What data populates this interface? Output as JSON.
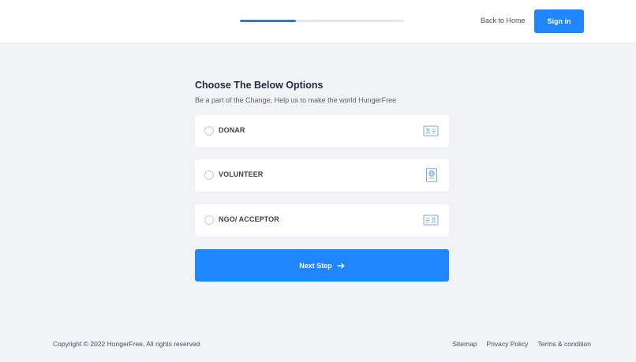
{
  "header": {
    "progress": 0.34,
    "back_home": "Back to Home",
    "sign_in": "Sign in"
  },
  "main": {
    "title": "Choose The Below Options",
    "subtitle": "Be a part of the Change, Help us to make the world HungerFree",
    "options": [
      {
        "label": "DONAR",
        "icon": "id-card-icon"
      },
      {
        "label": "VOLUNTEER",
        "icon": "passport-icon"
      },
      {
        "label": "NGO/ ACCEPTOR",
        "icon": "id-badge-icon"
      }
    ],
    "next_button": "Next Step"
  },
  "footer": {
    "copyright": "Copyright © 2022 HungerFree, All rights reserved",
    "links": [
      "Sitemap",
      "Privacy Policy",
      "Terms & condition"
    ]
  },
  "colors": {
    "accent": "#1f86ff",
    "background": "#f2f3f7",
    "icon": "#7fa7d6"
  }
}
